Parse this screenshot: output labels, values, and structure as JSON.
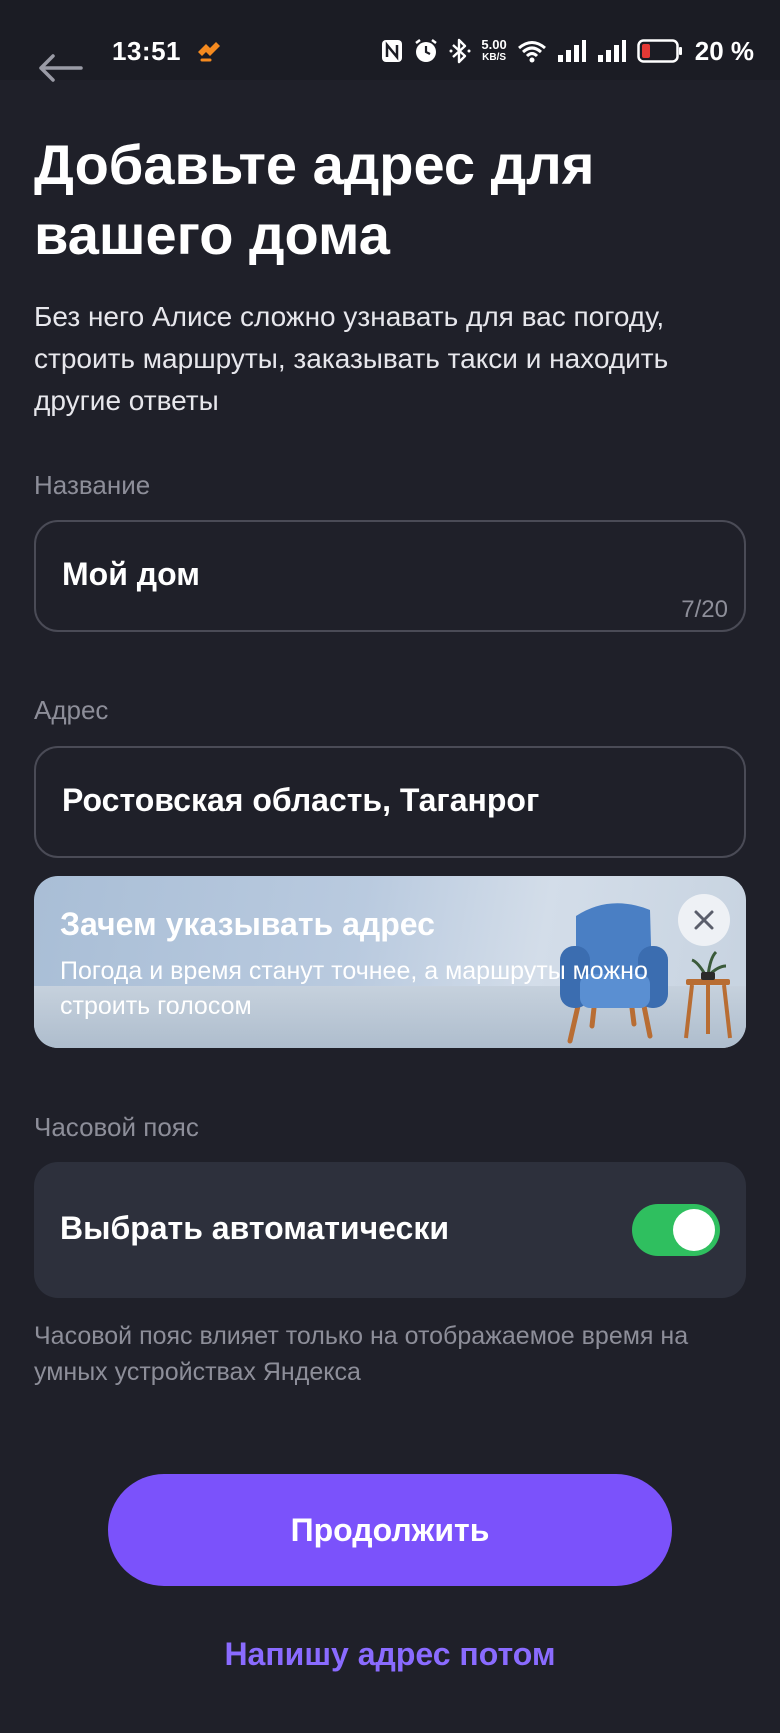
{
  "status_bar": {
    "time": "13:51",
    "net_speed_value": "5.00",
    "net_speed_unit": "KB/S",
    "battery_percent": "20 %",
    "icons": [
      "nfc-icon",
      "alarm-icon",
      "bluetooth-icon",
      "wifi-icon",
      "signal-icon",
      "signal-icon",
      "battery-icon"
    ]
  },
  "header": {
    "title": "Добавьте адрес для вашего дома",
    "subtitle": "Без него Алисе сложно узнавать для вас погоду, строить маршруты, заказывать такси и находить другие ответы"
  },
  "name_field": {
    "label": "Название",
    "value": "Мой дом",
    "counter": "7/20"
  },
  "address_field": {
    "label": "Адрес",
    "value": "Ростовская область, Таганрог"
  },
  "info_banner": {
    "title": "Зачем указывать адрес",
    "text": "Погода и время станут точнее, а маршруты можно строить голосом"
  },
  "timezone": {
    "label": "Часовой пояс",
    "option_label": "Выбрать автоматически",
    "toggle_on": true,
    "hint": "Часовой пояс влияет только на отображаемое время на умных устройствах Яндекса"
  },
  "actions": {
    "continue_label": "Продолжить",
    "later_label": "Напишу адрес потом"
  },
  "colors": {
    "background": "#1f2029",
    "accent": "#7b52fb",
    "link": "#8a6bff",
    "toggle": "#2fbf5f",
    "battery_low": "#e53935"
  }
}
